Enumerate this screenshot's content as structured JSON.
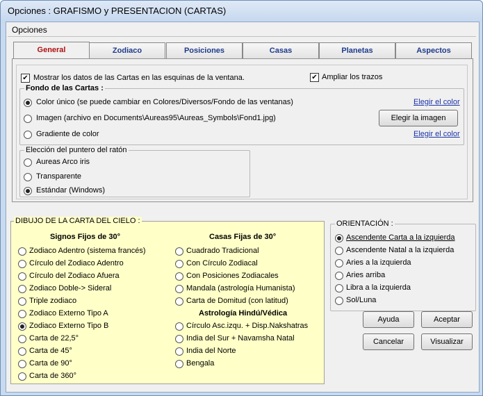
{
  "window": {
    "title": "Opciones : GRAFISMO y PRESENTACION (CARTAS)"
  },
  "group": {
    "label": "Opciones"
  },
  "tabs": [
    "General",
    "Zodiaco",
    "Posiciones",
    "Casas",
    "Planetas",
    "Aspectos"
  ],
  "general": {
    "show_data": "Mostrar los datos de las Cartas en las esquinas de la ventana.",
    "show_data_checked": true,
    "amplify": "Ampliar los trazos",
    "amplify_checked": true,
    "fondo_title": "Fondo de las Cartas :",
    "fondo_options": [
      "Color único (se puede cambiar en Colores/Diversos/Fondo de las ventanas)",
      "Imagen (archivo en Documents\\Aureas95\\Aureas_Symbols\\Fond1.jpg)",
      "Gradiente de color"
    ],
    "fondo_selected": 0,
    "choose_color": "Elegir el color",
    "choose_image": "Elegir la imagen",
    "pointer_title": "Elección del puntero del ratón",
    "pointer_options": [
      "Aureas Arco iris",
      "Transparente",
      "Estándar (Windows)"
    ],
    "pointer_selected": 2
  },
  "dibujo": {
    "title": "DIBUJO DE LA CARTA DEL CIELO :",
    "signos_head": "Signos Fijos de 30°",
    "signos": [
      "Zodiaco Adentro (sistema francés)",
      "Círculo del Zodiaco Adentro",
      "Círculo del Zodiaco Afuera",
      "Zodiaco Doble-> Sideral",
      "Triple zodiaco",
      "Zodiaco Externo Tipo A",
      "Zodiaco Externo Tipo B",
      "Carta de 22,5°",
      "Carta de 45°",
      "Carta de 90°",
      "Carta de 360°"
    ],
    "signos_selected": 6,
    "casas_head": "Casas Fijas de 30°",
    "casas": [
      "Cuadrado Tradicional",
      "Con Círculo Zodiacal",
      "Con Posiciones Zodiacales",
      "Mandala (astrología Humanista)",
      "Carta de Domitud (con latitud)"
    ],
    "hindu_head": "Astrología Hindú/Védica",
    "hindu": [
      "Círculo Asc.izqu. + Disp.Nakshatras",
      "India del Sur + Navamsha Natal",
      "India del Norte",
      "Bengala"
    ]
  },
  "orientacion": {
    "title": "ORIENTACIÓN :",
    "options": [
      "Ascendente Carta a la izquierda",
      "Ascendente Natal a la izquierda",
      "Aries a la izquierda",
      "Aries arriba",
      "Libra a la izquierda",
      "Sol/Luna"
    ],
    "selected": 0
  },
  "buttons": {
    "ayuda": "Ayuda",
    "aceptar": "Aceptar",
    "cancelar": "Cancelar",
    "visualizar": "Visualizar"
  }
}
